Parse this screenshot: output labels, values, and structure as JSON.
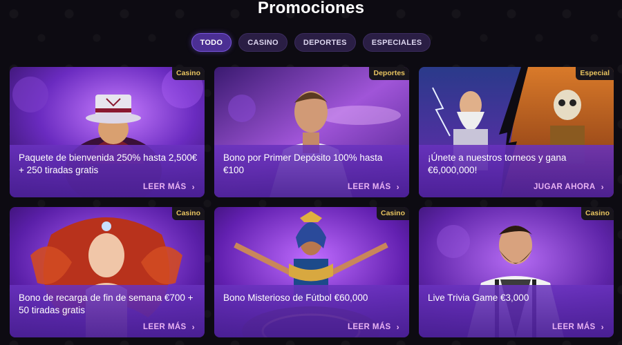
{
  "page": {
    "title": "Promociones"
  },
  "filters": [
    {
      "label": "TODO",
      "active": true
    },
    {
      "label": "CASINO",
      "active": false
    },
    {
      "label": "DEPORTES",
      "active": false
    },
    {
      "label": "ESPECIALES",
      "active": false
    }
  ],
  "cards": [
    {
      "badge": "Casino",
      "title": "Paquete de bienvenida 250% hasta 2,500€ + 250 tiradas gratis",
      "link": "LEER MÁS",
      "image": "hatter-character"
    },
    {
      "badge": "Deportes",
      "title": "Bono por Primer Depósito 100% hasta €100",
      "link": "LEER MÁS",
      "image": "football-player"
    },
    {
      "badge": "Especial",
      "title": "¡Únete a nuestros torneos y gana €6,000,000!",
      "link": "JUGAR AHORA",
      "image": "zeus-vs-skeleton"
    },
    {
      "badge": "Casino",
      "title": "Bono de recarga de fin de semana €700 + 50 tiradas gratis",
      "link": "LEER MÁS",
      "image": "red-haired-woman"
    },
    {
      "badge": "Casino",
      "title": "Bono Misterioso de Fútbol €60,000",
      "link": "LEER MÁS",
      "image": "cleopatra-roulette"
    },
    {
      "badge": "Casino",
      "title": "Live Trivia Game €3,000",
      "link": "LEER MÁS",
      "image": "bearded-man"
    }
  ],
  "colors": {
    "accent": "#4b2f93",
    "badge_text": "#e8c460",
    "link": "#e9b3f3"
  }
}
